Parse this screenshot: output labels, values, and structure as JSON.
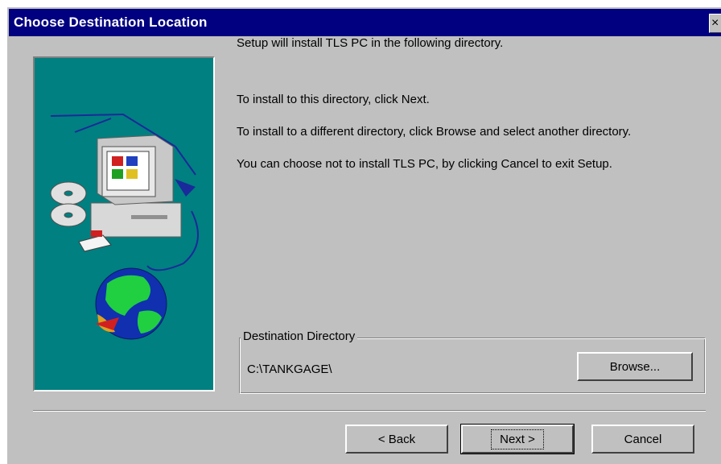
{
  "window": {
    "title": "Choose Destination Location",
    "close_glyph": "×"
  },
  "messages": [
    "Setup will install TLS PC in the following directory.",
    "To install to this directory, click Next.",
    "To install to a different directory, click Browse and select another directory.",
    "You can choose not to install TLS PC, by clicking Cancel to exit Setup."
  ],
  "destination": {
    "group_label": "Destination Directory",
    "path": "C:\\TANKGAGE\\",
    "browse_label": "Browse..."
  },
  "buttons": {
    "back_label": "< Back",
    "next_label": "Next >",
    "cancel_label": "Cancel"
  },
  "colors": {
    "title_bar": "#000080",
    "dialog_face": "#c0c0c0",
    "art_background": "#008080"
  },
  "icons": [
    "close-icon",
    "computer-icon",
    "cd-disc-icon",
    "floppy-disk-icon",
    "globe-icon"
  ]
}
